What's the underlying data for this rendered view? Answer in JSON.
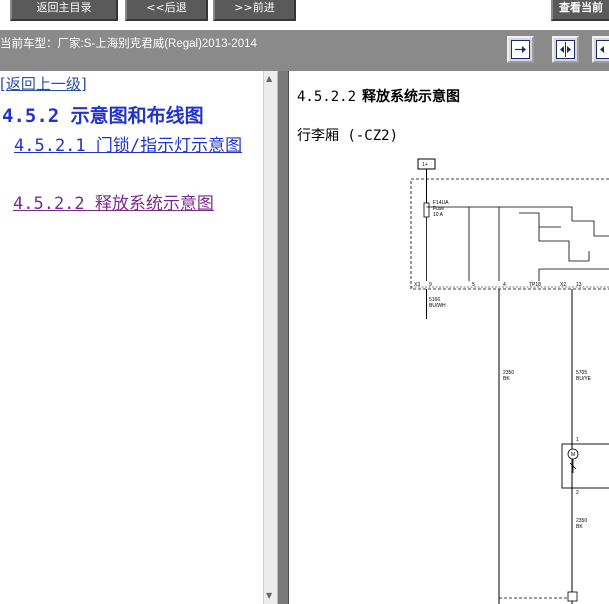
{
  "toolbar": {
    "main_label": "返回主目录",
    "back_label": "<<后退",
    "forward_label": ">>前进",
    "current_label": "查看当前"
  },
  "infobar": {
    "vehicle": "当前车型：厂家:S-上海别克君威(Regal)2013-2014"
  },
  "left_pane": {
    "back_link": "[返回上一级]",
    "section_heading": "4.5.2 示意图和布线图",
    "links": [
      "4.5.2.1 门锁/指示灯示意图",
      "4.5.2.2 释放系统示意图"
    ]
  },
  "right_pane": {
    "title_number": "4.5.2.2",
    "title_text": "释放系统示意图",
    "subtitle": "行李厢 (-CZ2)"
  },
  "diagram": {
    "top_box": "1+",
    "fuse": [
      "F14UA",
      "Fuse",
      "10 A"
    ],
    "pins": [
      "X3",
      "9",
      "5",
      "4",
      "TP18",
      "X2",
      "13"
    ],
    "wire_labels": [
      [
        "5166",
        "BU/WH"
      ],
      [
        "2350",
        "BK"
      ],
      [
        "5705",
        "BU/YE"
      ],
      [
        "2350",
        "BK"
      ]
    ],
    "component_labels": [
      "1",
      "M",
      "2"
    ]
  }
}
